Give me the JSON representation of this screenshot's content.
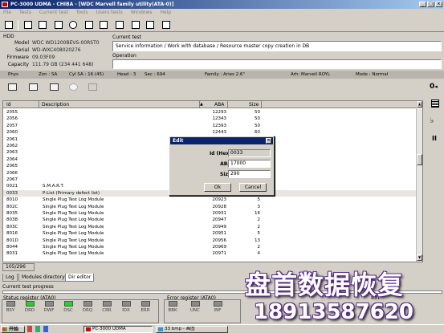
{
  "window": {
    "title": "PC-3000 UDMA - CHIBA - [WDC Marvell family utility(ATA-0)]"
  },
  "menu": [
    "File",
    "Tests",
    "Current test",
    "Tools",
    "Users tests",
    "Windows",
    "Help"
  ],
  "drive": {
    "section": "HDD",
    "model_label": "Model",
    "model": "WDC WD1200BEVS-00RST0",
    "serial_label": "Serial",
    "serial": "WD-WXC408020276",
    "firmware_label": "Firmware",
    "firmware": "09.03F09",
    "capacity_label": "Capacity",
    "capacity": "111.79 GB (234 441 648)"
  },
  "current_test": {
    "label": "Current test",
    "value": "Service information / Work with database / Resource master copy creation in DB",
    "operation_label": "Operation"
  },
  "phys_bar": {
    "phys": "Phys",
    "zone": "Zon : SA",
    "cyl": "Cyl SA : 16 (45)",
    "head": "Head : 3",
    "sec": "Sec : 694",
    "family": "Family : Aries 2.6\"",
    "arh": "Arh: Marvell ROYL",
    "mode": "Mode : Normal"
  },
  "table": {
    "columns": [
      "Id",
      "Description",
      "ABA",
      "Size"
    ],
    "rows": [
      {
        "id": "2055",
        "desc": "",
        "aba": "12293",
        "size": "50"
      },
      {
        "id": "2056",
        "desc": "",
        "aba": "12343",
        "size": "50"
      },
      {
        "id": "2057",
        "desc": "",
        "aba": "12393",
        "size": "50"
      },
      {
        "id": "2060",
        "desc": "",
        "aba": "12443",
        "size": "60"
      },
      {
        "id": "2061",
        "desc": "",
        "aba": "",
        "size": ""
      },
      {
        "id": "2062",
        "desc": "",
        "aba": "",
        "size": ""
      },
      {
        "id": "2063",
        "desc": "",
        "aba": "",
        "size": ""
      },
      {
        "id": "2064",
        "desc": "",
        "aba": "",
        "size": ""
      },
      {
        "id": "2065",
        "desc": "",
        "aba": "",
        "size": ""
      },
      {
        "id": "2066",
        "desc": "",
        "aba": "",
        "size": ""
      },
      {
        "id": "2067",
        "desc": "",
        "aba": "",
        "size": ""
      },
      {
        "id": "0021",
        "desc": "S.M.A.R.T.",
        "aba": "",
        "size": ""
      },
      {
        "id": "0033",
        "desc": "P-List (Primary defect list)",
        "aba": "18000",
        "size": "280"
      },
      {
        "id": "8010",
        "desc": "Single Plug Test Log Module",
        "aba": "20923",
        "size": "5"
      },
      {
        "id": "802C",
        "desc": "Single Plug Test Log Module",
        "aba": "20928",
        "size": "3"
      },
      {
        "id": "8035",
        "desc": "Single Plug Test Log Module",
        "aba": "20931",
        "size": "16"
      },
      {
        "id": "8038",
        "desc": "Single Plug Test Log Module",
        "aba": "20947",
        "size": "2"
      },
      {
        "id": "803C",
        "desc": "Single Plug Test Log Module",
        "aba": "20949",
        "size": "2"
      },
      {
        "id": "8016",
        "desc": "Single Plug Test Log Module",
        "aba": "20951",
        "size": "5"
      },
      {
        "id": "801D",
        "desc": "Single Plug Test Log Module",
        "aba": "20956",
        "size": "13"
      },
      {
        "id": "8044",
        "desc": "Single Plug Test Log Module",
        "aba": "20969",
        "size": "2"
      },
      {
        "id": "8031",
        "desc": "Single Plug Test Log Module",
        "aba": "20971",
        "size": "4"
      }
    ],
    "selected_row": 12,
    "counter": "105/296"
  },
  "dialog": {
    "title": "Edit",
    "id_label": "Id (Hex)",
    "id_value": "0033",
    "aba_label": "ABA",
    "aba_value": "17000",
    "size_label": "Size",
    "size_value": "290",
    "ok": "Ok",
    "cancel": "Cancel"
  },
  "tabs": [
    "Log",
    "Modules directory",
    "Dir editor"
  ],
  "current_progress_label": "Current test progress",
  "status_register": {
    "label": "Status register (ATA0)",
    "leds": [
      {
        "name": "BSY",
        "on": false
      },
      {
        "name": "DRD",
        "on": true
      },
      {
        "name": "DWF",
        "on": false
      },
      {
        "name": "DSC",
        "on": true
      },
      {
        "name": "DRQ",
        "on": false
      },
      {
        "name": "CRR",
        "on": false
      },
      {
        "name": "IDX",
        "on": false
      },
      {
        "name": "ERR",
        "on": false
      }
    ]
  },
  "error_register": {
    "label": "Error register (ATA0)",
    "leds": [
      {
        "name": "BBK"
      },
      {
        "name": "UNC"
      },
      {
        "name": "INF"
      }
    ]
  },
  "misc": {
    "corner_num": "831"
  },
  "watermark": {
    "title": "盘首数据恢复",
    "phone": "18913587620"
  },
  "taskbar": {
    "start": "开始",
    "tasks": [
      "PC-3000 UDMA",
      "33 bmp - 画图"
    ]
  }
}
